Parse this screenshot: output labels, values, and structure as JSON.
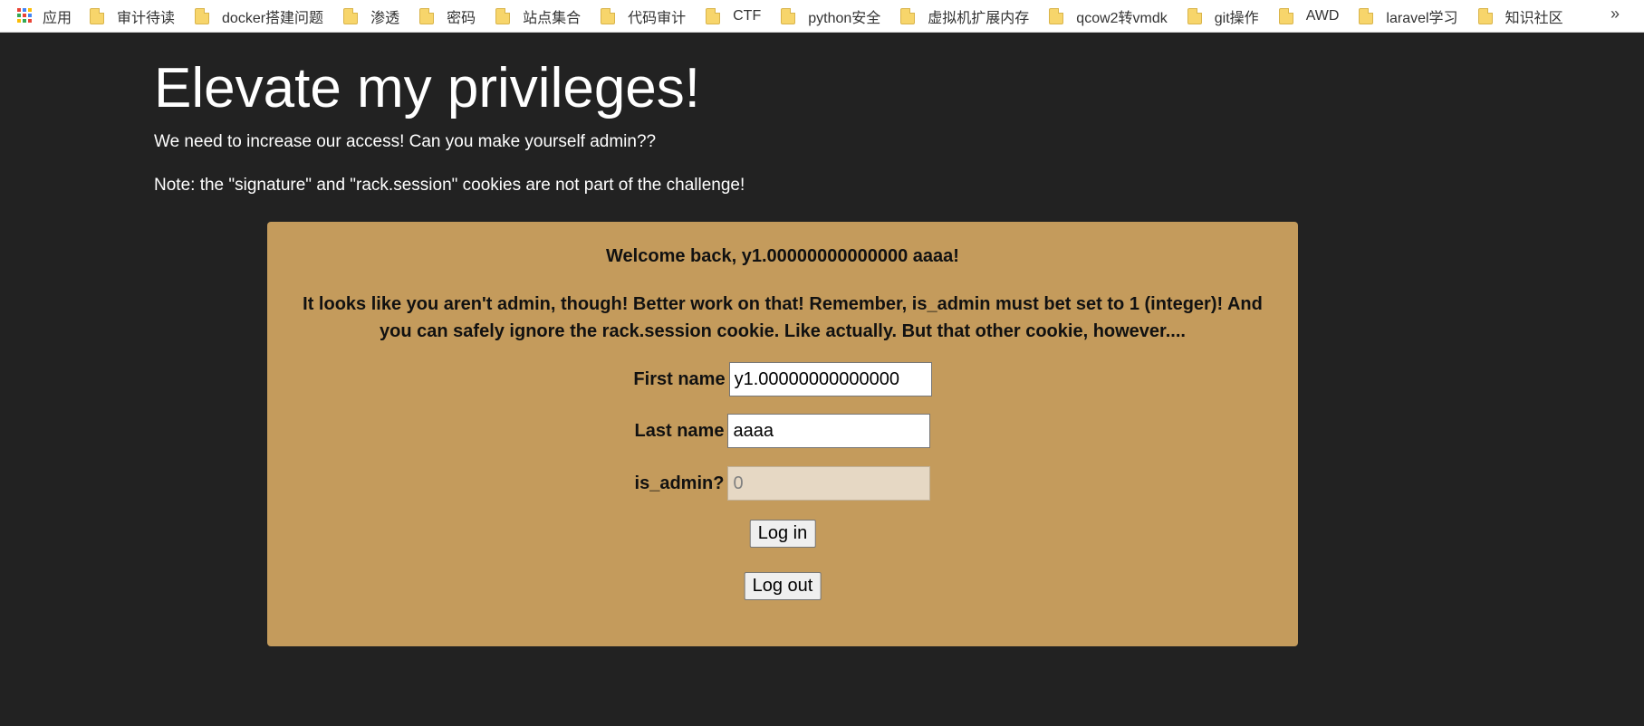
{
  "bookmarks": {
    "apps_label": "应用",
    "items": [
      "审计待读",
      "docker搭建问题",
      "渗透",
      "密码",
      "站点集合",
      "代码审计",
      "CTF",
      "python安全",
      "虚拟机扩展内存",
      "qcow2转vmdk",
      "git操作",
      "AWD",
      "laravel学习",
      "知识社区"
    ],
    "more": "»"
  },
  "page": {
    "title": "Elevate my privileges!",
    "intro": "We need to increase our access! Can you make yourself admin??",
    "note": "Note: the \"signature\" and \"rack.session\" cookies are not part of the challenge!"
  },
  "panel": {
    "welcome": "Welcome back, y1.00000000000000 aaaa!",
    "admin_note": "It looks like you aren't admin, though! Better work on that! Remember, is_admin must bet set to 1 (integer)! And you can safely ignore the rack.session cookie. Like actually. But that other cookie, however....",
    "first_name_label": "First name",
    "first_name_value": "y1.00000000000000",
    "last_name_label": "Last name",
    "last_name_value": "aaaa",
    "is_admin_label": "is_admin?",
    "is_admin_value": "0",
    "login_button": "Log in",
    "logout_button": "Log out"
  },
  "colors": {
    "background": "#222222",
    "panel": "#c49b5c",
    "text_light": "#ffffff"
  }
}
